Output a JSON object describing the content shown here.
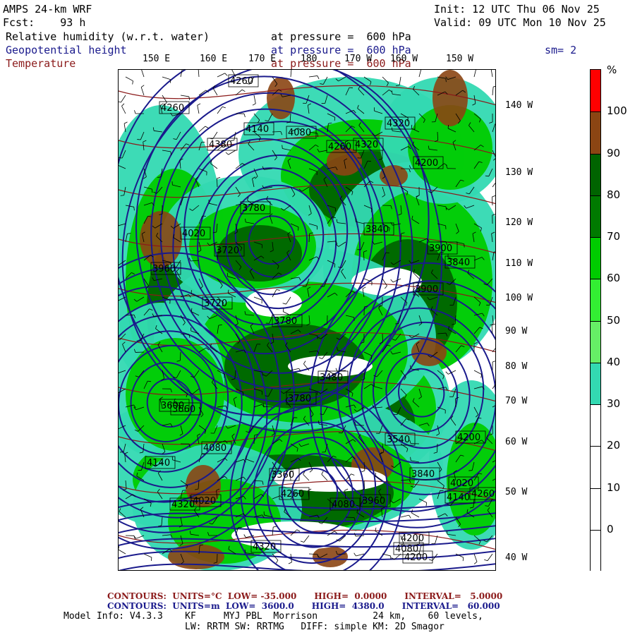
{
  "header": {
    "model_title": "AMPS 24-km WRF",
    "forecast_hour": "Fcst:    93 h",
    "init": "Init: 12 UTC Thu 06 Nov 25",
    "valid": "Valid: 09 UTC Mon 10 Nov 25",
    "rh_label": "Relative humidity (w.r.t. water)",
    "rh_level": "at pressure =  600 hPa",
    "geo_label": "Geopotential height",
    "geo_level": "at pressure =  600 hPa",
    "temp_label": "Temperature",
    "temp_level": "at pressure =  600 hPa",
    "smoothing": "sm= 2"
  },
  "longitude_top": [
    "150 E",
    "160 E",
    "170 E",
    "180",
    "170 W",
    "160 W",
    "150 W"
  ],
  "longitude_right": [
    "140 W",
    "130 W",
    "120 W",
    "110 W",
    "100 W",
    "90 W",
    "80 W",
    "70 W",
    "60 W",
    "50 W",
    "40 W"
  ],
  "colorbar": {
    "unit": "%",
    "ticks": [
      "100",
      "90",
      "80",
      "70",
      "60",
      "50",
      "40",
      "30",
      "20",
      "10",
      "0"
    ],
    "colors": [
      "#ff0000",
      "#8b4513",
      "#006400",
      "#007a00",
      "#00cc00",
      "#33ee33",
      "#66ee66",
      "#33d9b2",
      "#ffffff",
      "#ffffff",
      "#ffffff",
      "#ffffff"
    ]
  },
  "height_labels": [
    "4260",
    "4260",
    "4140",
    "4080",
    "4320",
    "4380",
    "4320",
    "4260",
    "4200",
    "4020",
    "3960",
    "3780",
    "3720",
    "3840",
    "3900",
    "3660",
    "3780",
    "3720",
    "3900",
    "3840",
    "3480",
    "3360",
    "3780",
    "3540",
    "3600",
    "4080",
    "4200",
    "4020",
    "4140",
    "4320",
    "4260",
    "4080",
    "3960",
    "3840",
    "4080",
    "4200",
    "4140",
    "4320",
    "4200",
    "4020",
    "4260"
  ],
  "footer": {
    "temp_contours": "CONTOURS:  UNITS=°C  LOW= -35.000      HIGH=  0.0000      INTERVAL=   5.0000",
    "geo_contours": "CONTOURS:  UNITS=m  LOW=  3600.0      HIGH=  4380.0      INTERVAL=   60.000",
    "model_info": "Model Info: V4.3.3    KF     MYJ PBL  Morrison          24 km,    60 levels,",
    "physics": "LW: RRTM SW: RRTMG   DIFF: simple KM: 2D Smagor"
  }
}
